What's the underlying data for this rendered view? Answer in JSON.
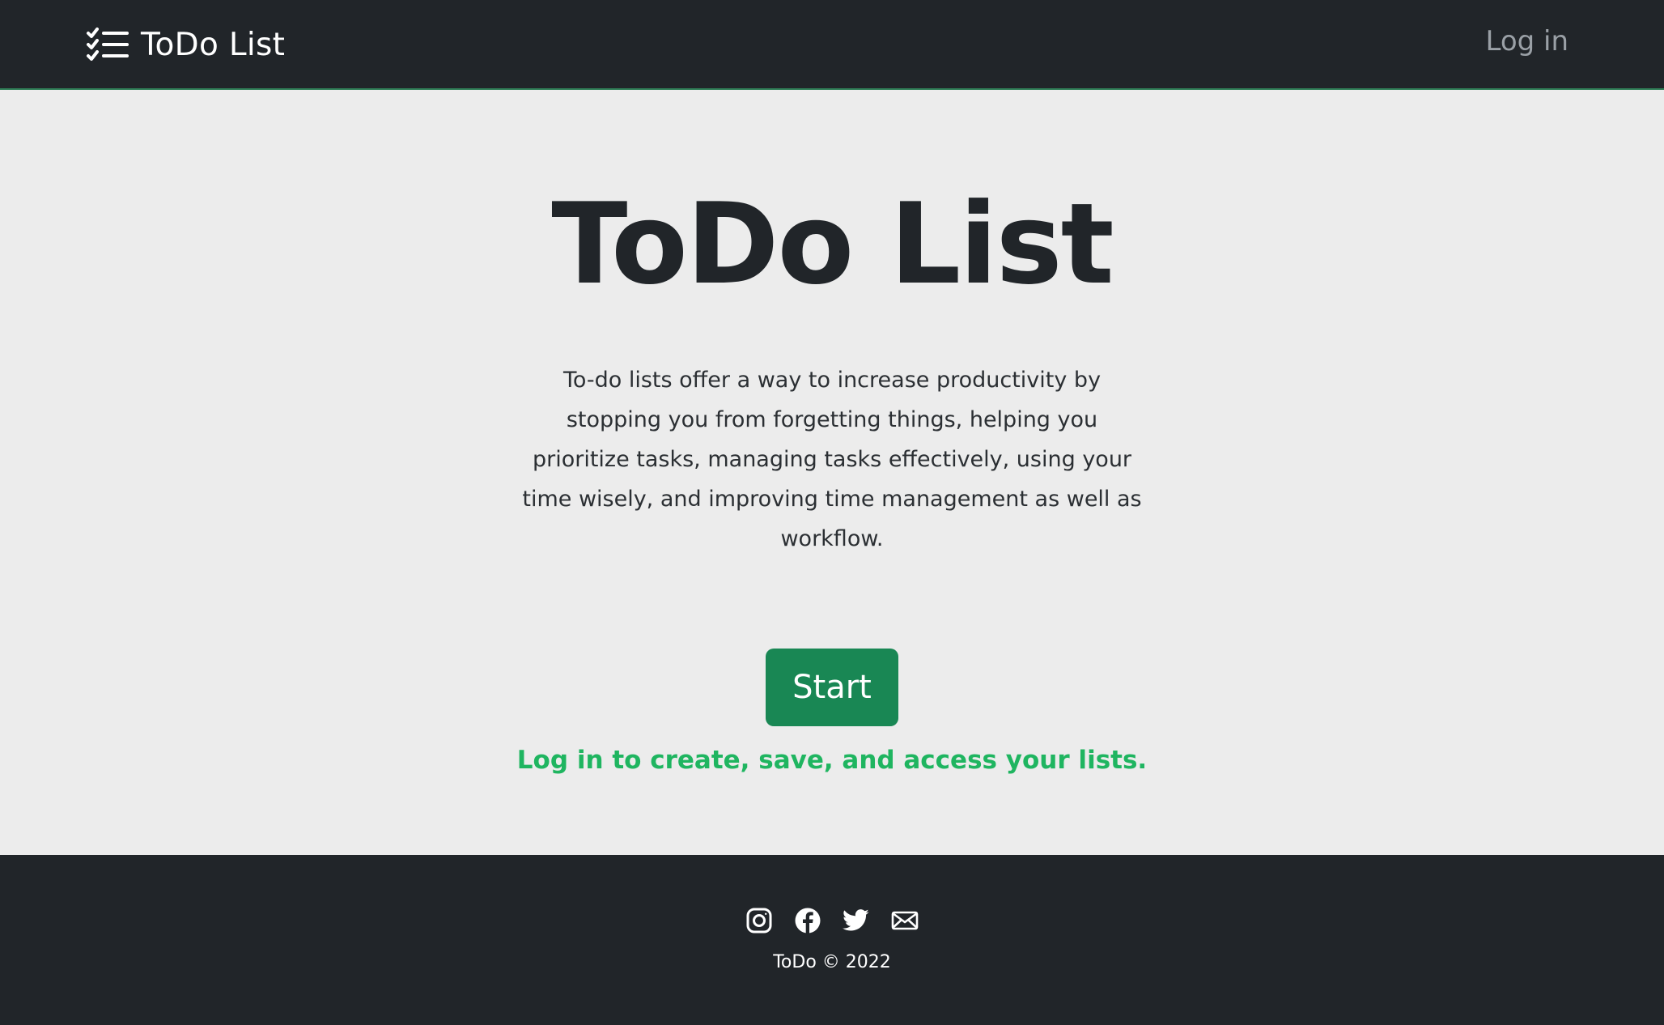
{
  "navbar": {
    "brand_text": "ToDo List",
    "brand_icon": "checklist-icon",
    "login_label": "Log in"
  },
  "hero": {
    "title": "ToDo List",
    "description": "To-do lists offer a way to increase productivity by stopping you from forgetting things, helping you prioritize tasks, managing tasks effectively, using your time wisely, and improving time management as well as workflow.",
    "start_label": "Start",
    "login_hint": "Log in to create, save, and access your lists."
  },
  "footer": {
    "social_icons": [
      "instagram-icon",
      "facebook-icon",
      "twitter-icon",
      "mail-icon"
    ],
    "copyright": "ToDo © 2022"
  },
  "colors": {
    "navbar_bg": "#212529",
    "page_bg": "#ececec",
    "accent_green": "#198754",
    "hint_green": "#1fb560"
  }
}
